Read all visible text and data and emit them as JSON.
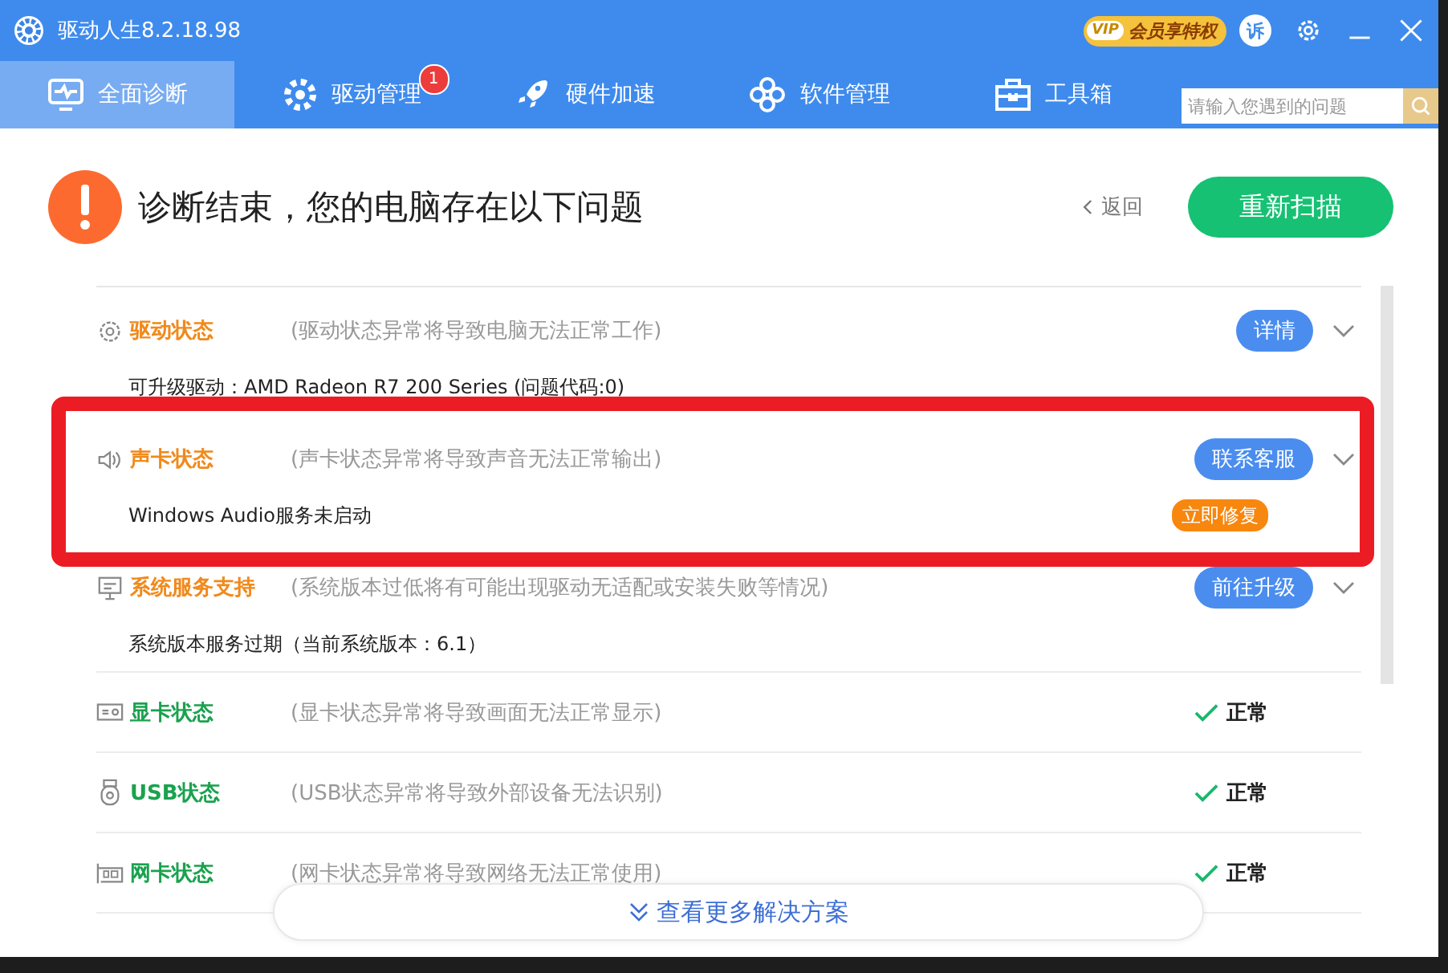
{
  "window": {
    "title": "驱动人生8.2.18.98",
    "vip_label": "VIP",
    "vip_text": "会员享特权",
    "complaint_label": "诉"
  },
  "tabs": [
    {
      "label": "全面诊断",
      "selected": true
    },
    {
      "label": "驱动管理",
      "selected": false,
      "badge": "1"
    },
    {
      "label": "硬件加速",
      "selected": false
    },
    {
      "label": "软件管理",
      "selected": false
    },
    {
      "label": "工具箱",
      "selected": false
    }
  ],
  "search": {
    "placeholder": "请输入您遇到的问题"
  },
  "header": {
    "title": "诊断结束，您的电脑存在以下问题",
    "back": "返回",
    "rescan": "重新扫描"
  },
  "items": [
    {
      "kind": "problem",
      "title": "驱动状态",
      "desc": "(驱动状态异常将导致电脑无法正常工作)",
      "action": "详情",
      "detail": "可升级驱动：AMD Radeon R7 200 Series (问题代码:0)",
      "highlighted": false
    },
    {
      "kind": "problem",
      "title": "声卡状态",
      "desc": "(声卡状态异常将导致声音无法正常输出)",
      "action": "联系客服",
      "detail": "Windows Audio服务未启动",
      "fix": "立即修复",
      "highlighted": true
    },
    {
      "kind": "problem",
      "title": "系统服务支持",
      "desc": "(系统版本过低将有可能出现驱动无适配或安装失败等情况)",
      "action": "前往升级",
      "detail": "系统版本服务过期（当前系统版本：6.1）",
      "highlighted": false
    },
    {
      "kind": "ok",
      "title": "显卡状态",
      "desc": "(显卡状态异常将导致画面无法正常显示)",
      "status": "正常"
    },
    {
      "kind": "ok",
      "title": "USB状态",
      "desc": "(USB状态异常将导致外部设备无法识别)",
      "status": "正常"
    },
    {
      "kind": "ok",
      "title": "网卡状态",
      "desc": "(网卡状态异常将导致网络无法正常使用)",
      "status": "正常"
    }
  ],
  "more": "查看更多解决方案"
}
